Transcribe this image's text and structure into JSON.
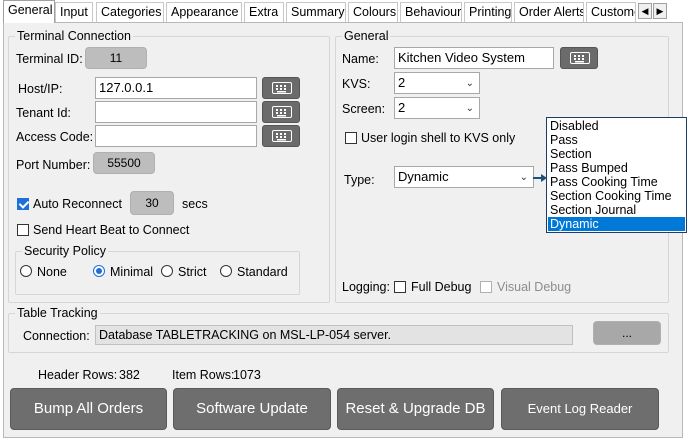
{
  "tabs": [
    {
      "label": "General"
    },
    {
      "label": "Input"
    },
    {
      "label": "Categories"
    },
    {
      "label": "Appearance"
    },
    {
      "label": "Extra"
    },
    {
      "label": "Summary"
    },
    {
      "label": "Colours"
    },
    {
      "label": "Behaviour"
    },
    {
      "label": "Printing"
    },
    {
      "label": "Order Alerts"
    },
    {
      "label": "Custome"
    }
  ],
  "tab_scroll": {
    "left": "◀",
    "right": "▶"
  },
  "terminal": {
    "legend": "Terminal Connection",
    "terminal_id_label": "Terminal ID:",
    "terminal_id_value": "11",
    "host_label": "Host/IP:",
    "host_value": "127.0.0.1",
    "tenant_label": "Tenant Id:",
    "tenant_value": "",
    "access_label": "Access Code:",
    "access_value": "",
    "port_label": "Port Number:",
    "port_value": "55500",
    "auto_reconnect_label": "Auto Reconnect",
    "auto_reconnect_checked": true,
    "auto_reconnect_value": "30",
    "auto_reconnect_unit": "secs",
    "heartbeat_label": "Send Heart Beat to Connect",
    "heartbeat_checked": false,
    "security": {
      "legend": "Security Policy",
      "options": [
        "None",
        "Minimal",
        "Strict",
        "Standard"
      ],
      "selected": "Minimal"
    }
  },
  "general": {
    "legend": "General",
    "name_label": "Name:",
    "name_value": "Kitchen Video System",
    "kvs_label": "KVS:",
    "kvs_value": "2",
    "screen_label": "Screen:",
    "screen_value": "2",
    "login_shell_label": "User login shell to KVS only",
    "login_shell_checked": false,
    "type_label": "Type:",
    "type_value": "Dynamic",
    "type_options": [
      "Disabled",
      "Pass",
      "Section",
      "Pass Bumped",
      "Pass Cooking Time",
      "Section Cooking Time",
      "Section Journal",
      "Dynamic"
    ],
    "logging_label": "Logging:",
    "full_debug_label": "Full Debug",
    "visual_debug_label": "Visual Debug"
  },
  "table_tracking": {
    "legend": "Table Tracking",
    "connection_label": "Connection:",
    "connection_value": "Database TABLETRACKING on MSL-LP-054 server.",
    "browse_label": "..."
  },
  "stats": {
    "header_rows_label": "Header Rows:",
    "header_rows_value": "382",
    "item_rows_label": "Item Rows:",
    "item_rows_value": "1073"
  },
  "buttons": {
    "bump_all": "Bump All Orders",
    "software_update": "Software Update",
    "reset_upgrade": "Reset & Upgrade DB",
    "event_log": "Event Log Reader"
  },
  "colors": {
    "accent": "#1e6fd9",
    "button_gray": "#6e6e6e",
    "selected_item": "#0078d7"
  }
}
